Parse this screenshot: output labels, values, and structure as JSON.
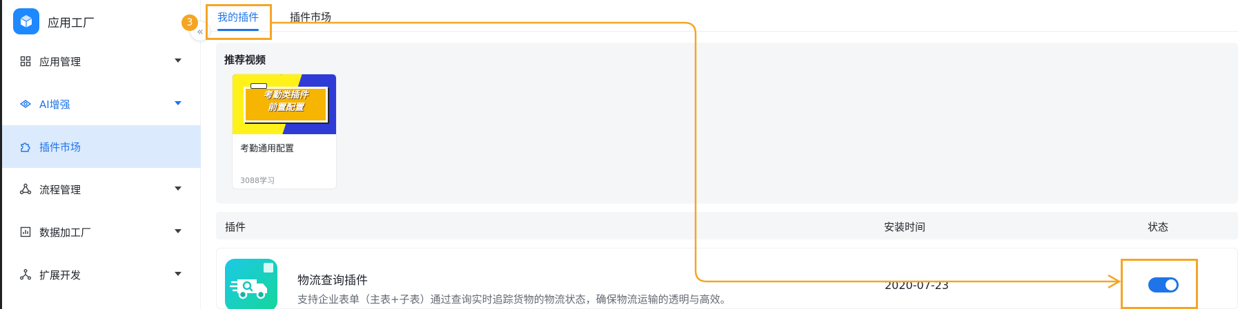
{
  "app": {
    "title": "应用工厂",
    "logo_icon": "cube-icon",
    "accent_color": "#1e74e8"
  },
  "sidebar": {
    "items": [
      {
        "label": "应用管理",
        "icon": "grid-icon",
        "expandable": true
      },
      {
        "label": "AI增强",
        "icon": "ai-icon",
        "expandable": true
      },
      {
        "label": "插件市场",
        "icon": "puzzle-icon",
        "expandable": false,
        "active": true
      },
      {
        "label": "流程管理",
        "icon": "flow-icon",
        "expandable": true
      },
      {
        "label": "数据加工厂",
        "icon": "chart-icon",
        "expandable": true
      },
      {
        "label": "扩展开发",
        "icon": "extension-icon",
        "expandable": true
      }
    ],
    "collapse_icon": "double-chevron-left-icon"
  },
  "annotation": {
    "step_number": "3",
    "color": "#f5a524"
  },
  "tabs": [
    {
      "label": "我的插件",
      "active": true
    },
    {
      "label": "插件市场",
      "active": false
    }
  ],
  "videos": {
    "section_title": "推荐视频",
    "items": [
      {
        "thumbnail_text_line1": "考勤类插件",
        "thumbnail_text_line2": "前置配置",
        "title": "考勤通用配置",
        "views": "3088学习"
      }
    ]
  },
  "plugin_table": {
    "columns": [
      "插件",
      "安装时间",
      "状态"
    ],
    "rows": [
      {
        "icon": "delivery-truck-icon",
        "name": "物流查询插件",
        "description": "支持企业表单（主表+子表）通过查询实时追踪货物的物流状态，确保物流运输的透明与高效。",
        "install_date": "2020-07-23",
        "enabled": true
      }
    ]
  }
}
